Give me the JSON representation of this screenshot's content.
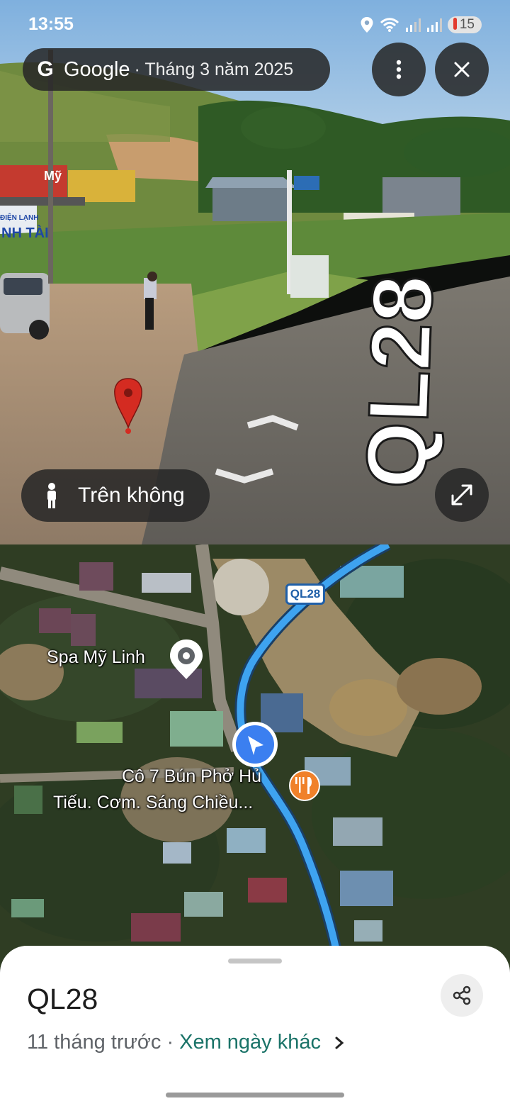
{
  "status_bar": {
    "time": "13:55",
    "battery": "15"
  },
  "street_view": {
    "provider": "Google",
    "capture_date": "· Tháng 3 năm 2025",
    "view_mode_label": "Trên không",
    "road_marking": "QL28",
    "storefront_signs": [
      "Mỹ",
      "ĐIỆN LẠNH",
      "NH TÀI"
    ]
  },
  "map": {
    "route_shield": "QL28",
    "place_1": "Spa Mỹ Linh",
    "place_2_line1": "Cô 7 Bún Phở Hủ",
    "place_2_line2": "Tiếu. Cơm. Sáng Chiều..."
  },
  "sheet": {
    "title": "QL28",
    "age": "11 tháng trước",
    "separator": "·",
    "other_dates_link": "Xem ngày khác"
  },
  "colors": {
    "route_blue": "#3ea3f0",
    "nav_arrow_bg": "#3b7ff0",
    "food_pin": "#f0812a",
    "link_teal": "#1a7368"
  }
}
